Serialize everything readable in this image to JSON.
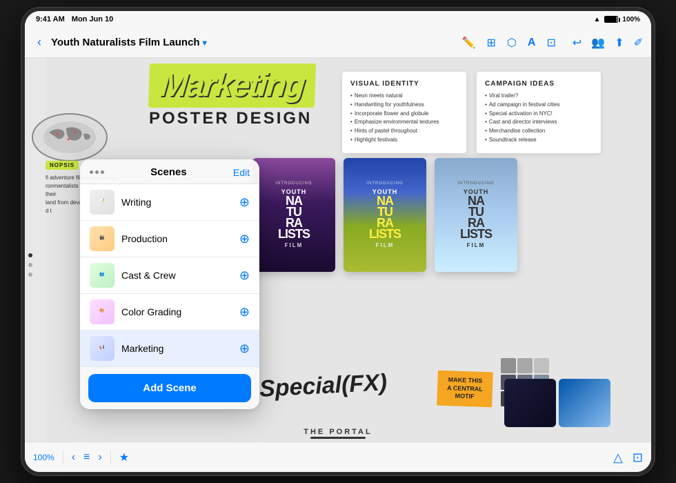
{
  "device": {
    "time": "9:41 AM",
    "date": "Mon Jun 10",
    "battery": "100%",
    "wifi": true
  },
  "nav": {
    "title": "Youth Naturalists Film Launch",
    "back_label": "‹",
    "chevron": "▾",
    "edit_label": "Edit"
  },
  "toolbar": {
    "zoom": "100%",
    "add_scene_label": "Add Scene"
  },
  "scenes_panel": {
    "title": "Scenes",
    "edit_label": "Edit",
    "items": [
      {
        "id": "writing",
        "name": "Writing",
        "active": false
      },
      {
        "id": "production",
        "name": "Production",
        "active": false
      },
      {
        "id": "cast-crew",
        "name": "Cast & Crew",
        "active": false
      },
      {
        "id": "color-grading",
        "name": "Color Grading",
        "active": false
      },
      {
        "id": "marketing",
        "name": "Marketing",
        "active": true
      }
    ]
  },
  "canvas": {
    "marketing_title": "Marketing",
    "poster_design": "POSTER DESIGN",
    "synopsis_badge": "NOPSIS",
    "synopsis_text": "fi adventure film about young\nironmentalists working to protect their\nland from devastation. Through their\nd t",
    "special_fx": "Special(FX)",
    "motif_text": "MAKE THIS A CENTRAL MOTIF",
    "portal_text": "THE PORTAL",
    "visual_identity": {
      "title": "VISUAL IDENTITY",
      "items": [
        "Neon meets natural",
        "Handwriting for youthfulness",
        "Incorporate flower and globule",
        "Emphasize environmental textures",
        "Hints of pastel throughout",
        "Highlight festivals"
      ]
    },
    "campaign_ideas": {
      "title": "CAMPAIGN IDEAS",
      "items": [
        "Viral trailer?",
        "Ad campaign in festival cities",
        "Special activation in NYC!",
        "Cast and director interviews",
        "Merchandise collection",
        "Soundtrack release"
      ]
    }
  },
  "color_swatches": [
    "#8a8a8a",
    "#a0a0a0",
    "#b8b8b8",
    "#505060",
    "#6a6a7a",
    "#8a8a9a",
    "#404040",
    "#585858",
    "#707070"
  ],
  "icons": {
    "pen": "✏️",
    "grid": "⊞",
    "shape": "⬡",
    "text": "T",
    "image": "⊡",
    "undo": "↩",
    "collab": "👥",
    "share": "⬆",
    "edit_mode": "✐",
    "more": "⊙",
    "chevron_left": "‹",
    "chevron_right": "›",
    "list": "≡",
    "star": "★",
    "draw": "🖊",
    "aspect": "⊡"
  }
}
